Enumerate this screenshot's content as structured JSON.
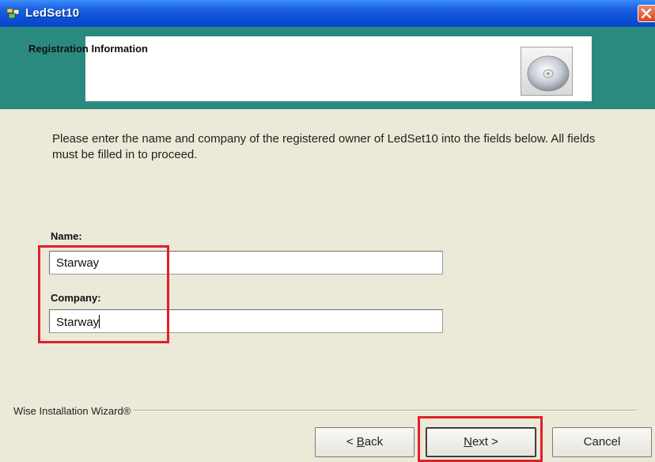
{
  "window": {
    "title": "LedSet10",
    "close_glyph": "✕"
  },
  "header": {
    "title": "Registration Information"
  },
  "instructions": "Please enter the name and company of the registered owner of LedSet10 into the fields below. All fields must be filled in to proceed.",
  "form": {
    "name_label": "Name:",
    "name_value": "Starway",
    "company_label": "Company:",
    "company_value": "Starway"
  },
  "footer": {
    "brand": "Wise Installation Wizard®",
    "back": {
      "prefix": "< ",
      "accel": "B",
      "rest": "ack"
    },
    "next": {
      "accel": "N",
      "rest": "ext >"
    },
    "cancel": "Cancel"
  },
  "colors": {
    "header_band": "#2b8a80",
    "titlebar": "#0a4fd6",
    "highlight": "#e0202a"
  }
}
